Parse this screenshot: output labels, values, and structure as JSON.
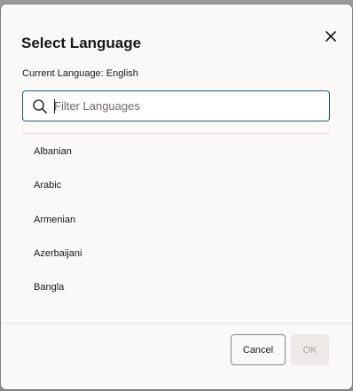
{
  "dialog": {
    "title": "Select Language",
    "current_language_label": "Current Language:",
    "current_language_value": "English",
    "close_icon": "close-icon"
  },
  "search": {
    "placeholder": "Filter Languages",
    "value": "",
    "icon": "search-icon"
  },
  "languages": [
    "Albanian",
    "Arabic",
    "Armenian",
    "Azerbaijani",
    "Bangla"
  ],
  "footer": {
    "cancel_label": "Cancel",
    "ok_label": "OK",
    "ok_enabled": false
  },
  "colors": {
    "accent_border": "#1f5e6c",
    "dialog_background": "#faf9f8",
    "text": "#1a1816",
    "disabled_button": "#ece9e6"
  }
}
